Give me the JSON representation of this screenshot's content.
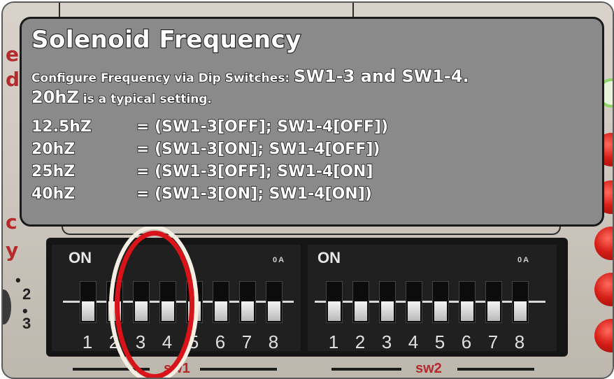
{
  "info_box": {
    "title": "Solenoid Frequency",
    "intro_prefix": "Configure Frequency via Dip Switches: ",
    "intro_switches": "SW1-3 and SW1-4.",
    "typical_value": "20hZ",
    "typical_suffix": " is a typical setting.",
    "settings": [
      {
        "freq": "12.5hZ",
        "config": "= (SW1-3[OFF]; SW1-4[OFF])"
      },
      {
        "freq": "20hZ",
        "config": "= (SW1-3[ON]; SW1-4[OFF])"
      },
      {
        "freq": "25hZ",
        "config": "= (SW1-3[OFF]; SW1-4[ON]"
      },
      {
        "freq": "40hZ",
        "config": "= (SW1-3[ON]; SW1-4[ON])"
      }
    ]
  },
  "dip_switches": {
    "bank1": {
      "on_label": "ON",
      "corner_label": "0A",
      "label": "sw1",
      "numbers": [
        "1",
        "2",
        "3",
        "4",
        "5",
        "6",
        "7",
        "8"
      ]
    },
    "bank2": {
      "on_label": "ON",
      "corner_label": "0A",
      "label": "sw2",
      "numbers": [
        "1",
        "2",
        "3",
        "4",
        "5",
        "6",
        "7",
        "8"
      ]
    }
  },
  "side_pins": [
    "2",
    "3"
  ],
  "colors": {
    "highlight": "#d8141a",
    "info_bg": "#8a8a8a",
    "led": "#d61f17"
  }
}
